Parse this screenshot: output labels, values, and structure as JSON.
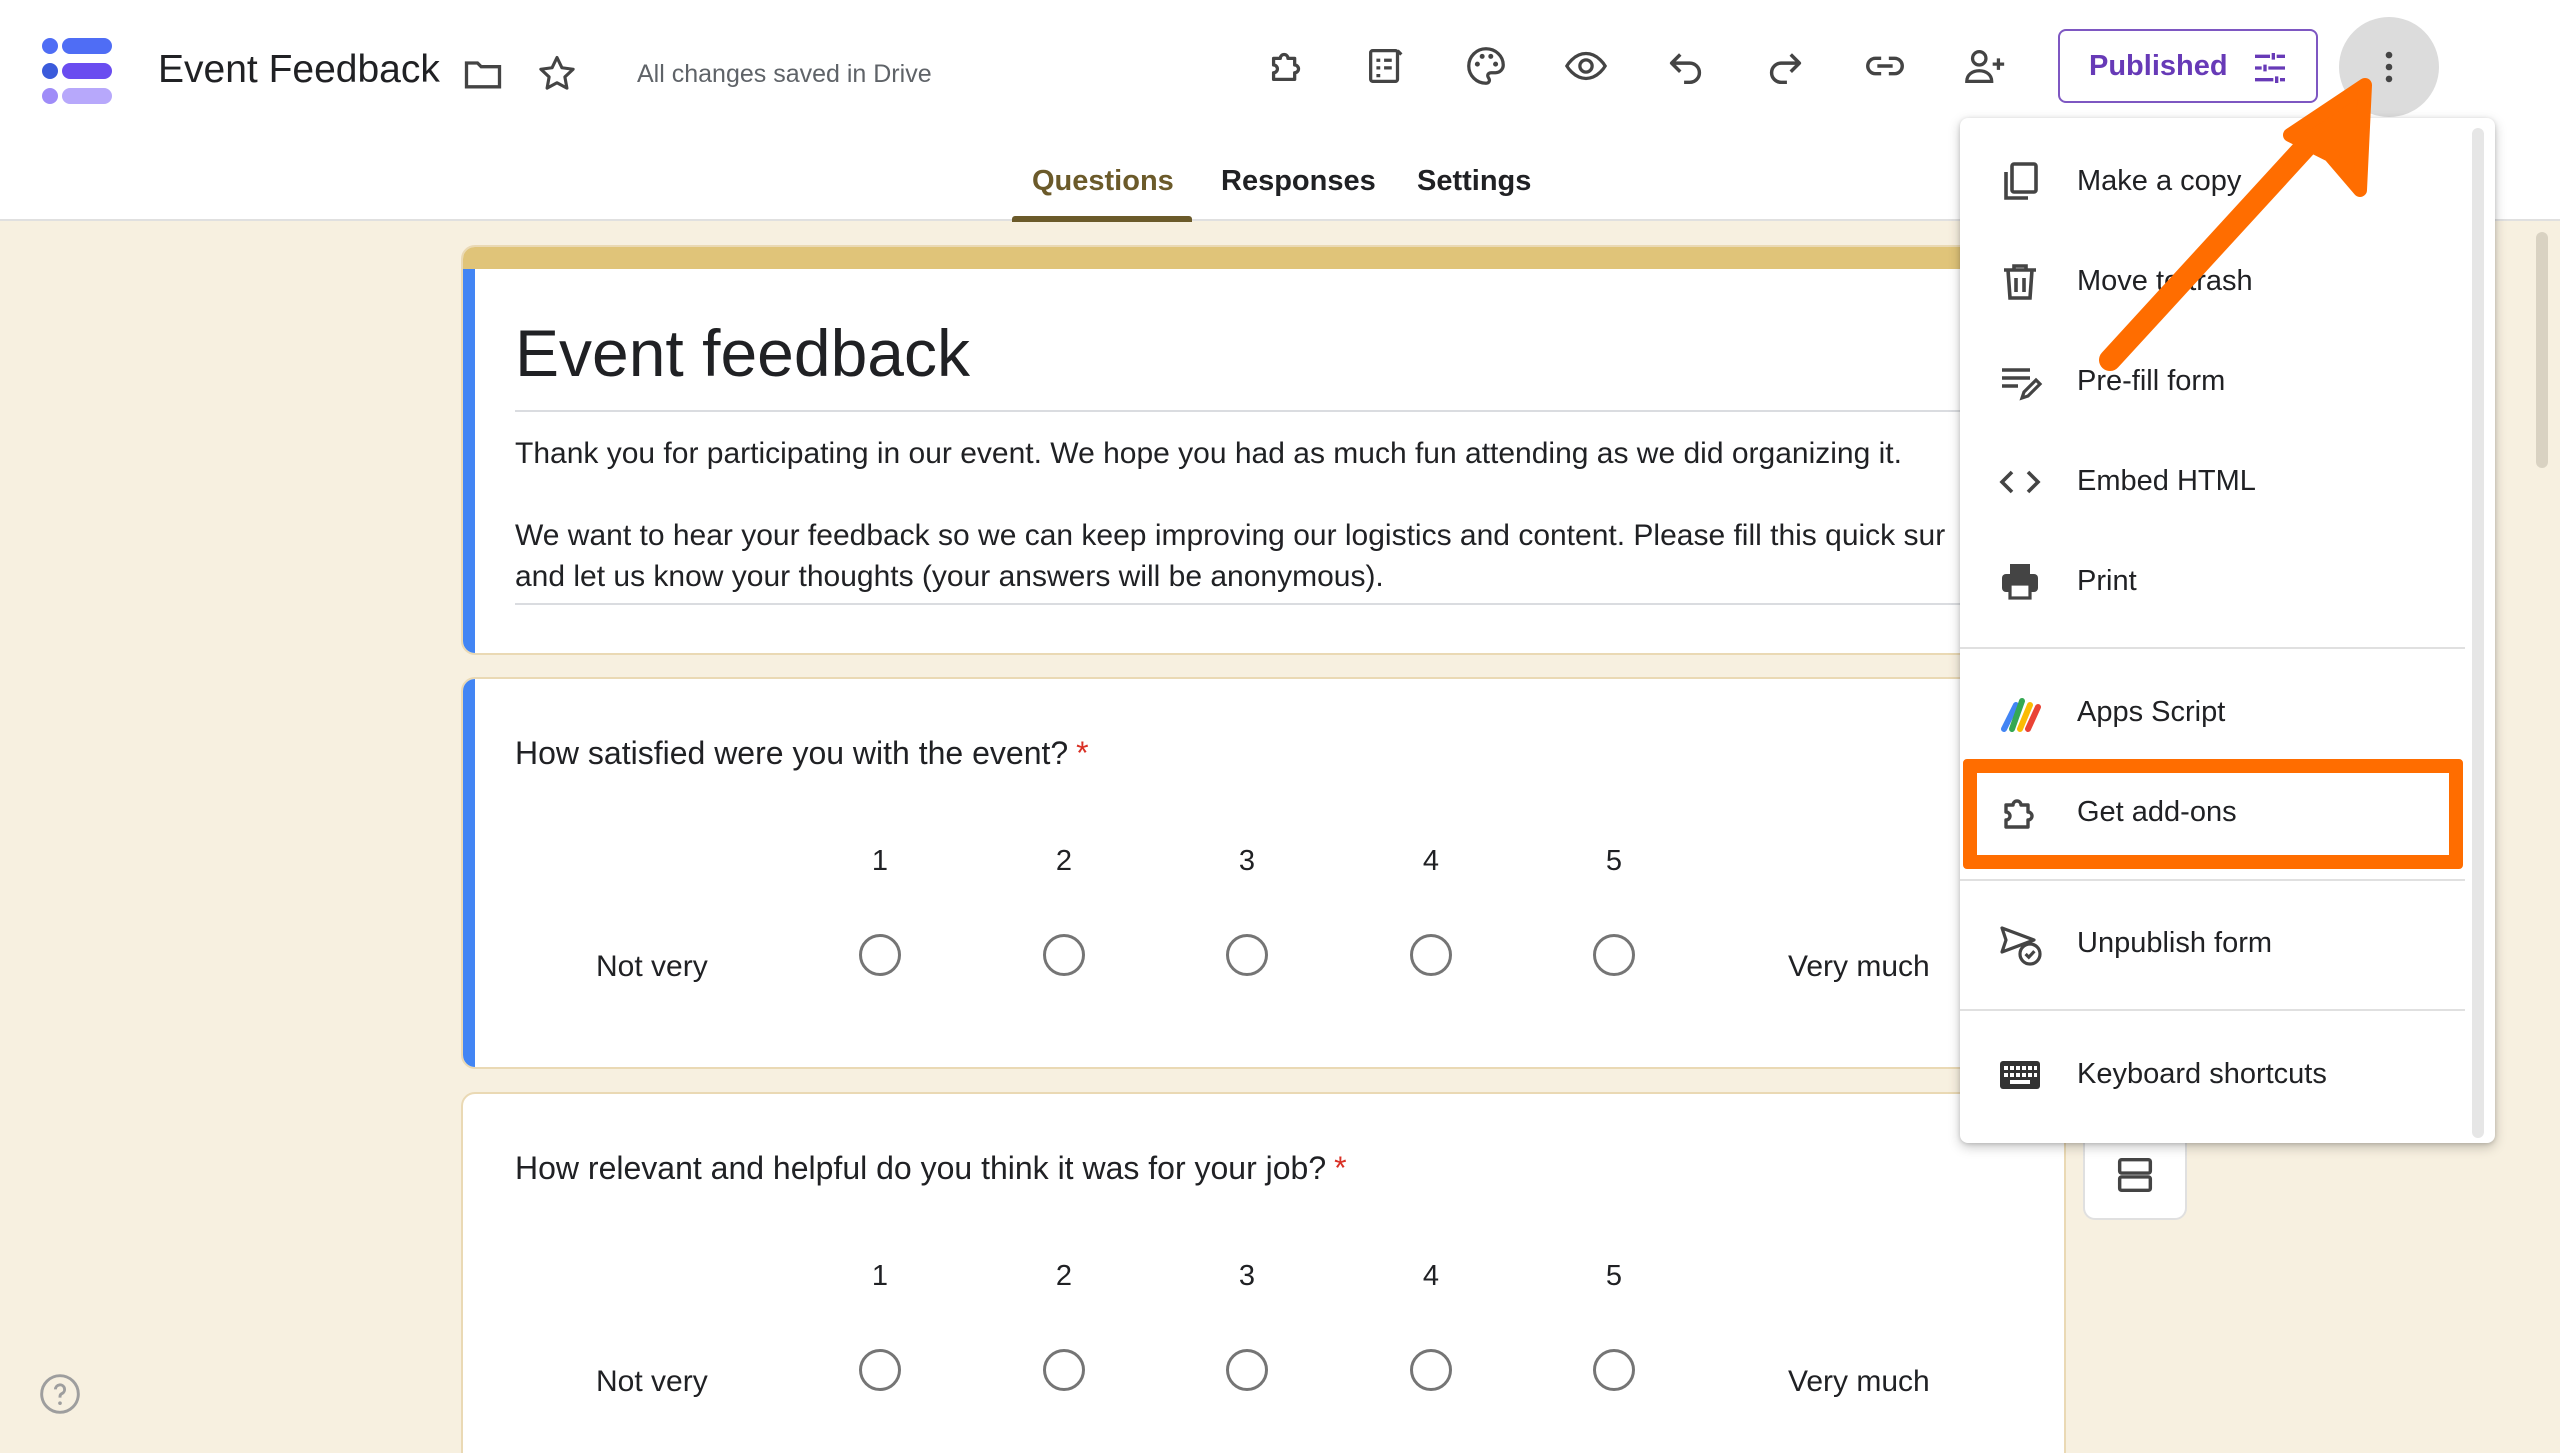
{
  "header": {
    "doc_title": "Event Feedback",
    "save_status": "All changes saved in Drive",
    "publish_label": "Published"
  },
  "tabs": [
    {
      "label": "Questions",
      "active": true
    },
    {
      "label": "Responses",
      "active": false
    },
    {
      "label": "Settings",
      "active": false
    }
  ],
  "form": {
    "title": "Event feedback",
    "description_lines": [
      "Thank you for participating in our event. We hope you had as much fun attending as we did organizing it.",
      "We want to hear your feedback so we can keep improving our logistics and content. Please fill this quick sur",
      "and let us know your thoughts (your answers will be anonymous)."
    ]
  },
  "questions": [
    {
      "text": "How satisfied were you with the event?",
      "required_mark": "*",
      "scale": [
        "1",
        "2",
        "3",
        "4",
        "5"
      ],
      "low_label": "Not very",
      "high_label": "Very much"
    },
    {
      "text": "How relevant and helpful do you think it was for your job?",
      "required_mark": "*",
      "scale": [
        "1",
        "2",
        "3",
        "4",
        "5"
      ],
      "low_label": "Not very",
      "high_label": "Very much"
    }
  ],
  "menu": {
    "items": [
      {
        "label": "Make a copy",
        "icon": "copy-icon"
      },
      {
        "label": "Move to trash",
        "icon": "trash-icon"
      },
      {
        "label": "Pre-fill form",
        "icon": "prefill-icon"
      },
      {
        "label": "Embed HTML",
        "icon": "code-icon"
      },
      {
        "label": "Print",
        "icon": "print-icon"
      },
      {
        "label": "Apps Script",
        "icon": "apps-script-icon"
      },
      {
        "label": "Get add-ons",
        "icon": "addon-icon",
        "highlighted": true
      },
      {
        "label": "Unpublish form",
        "icon": "unpublish-icon"
      },
      {
        "label": "Keyboard shortcuts",
        "icon": "keyboard-icon"
      }
    ]
  },
  "colors": {
    "accent": "#673ab7",
    "highlight": "#ff6d00",
    "theme_stripe": "#e0c479",
    "question_accent": "#4285f4",
    "background": "#f7f0e0"
  }
}
